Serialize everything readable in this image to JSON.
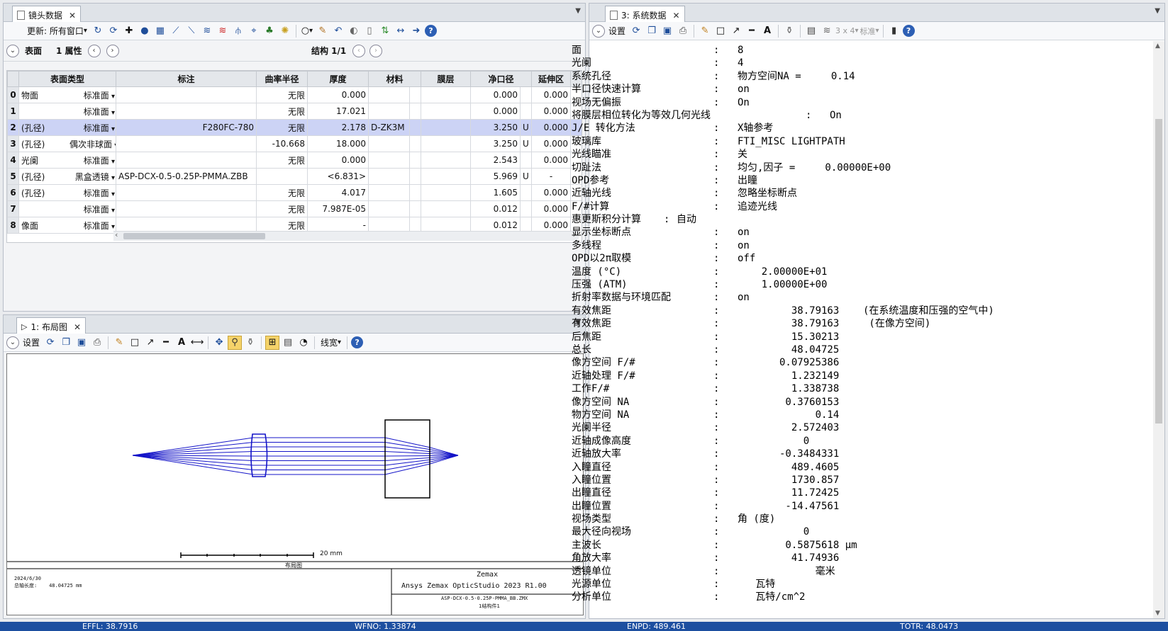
{
  "lens_panel": {
    "tab_title": "镜头数据",
    "toolbar_update_label": "更新: 所有窗口",
    "nav_surface_label": "表面",
    "nav_props_label": "1 属性",
    "nav_config_label": "结构 1/1",
    "columns": [
      "表面类型",
      "标注",
      "曲率半径",
      "厚度",
      "材料",
      "膜层",
      "净口径",
      "延伸区"
    ],
    "rows": [
      {
        "idx": "0",
        "name": "物面",
        "type": "标准面",
        "comment": "",
        "radius": "无限",
        "thickness": "0.000",
        "material": "",
        "coating": "",
        "clear": "0.000",
        "u": "",
        "ext": "0.000"
      },
      {
        "idx": "1",
        "name": "",
        "type": "标准面",
        "comment": "",
        "radius": "无限",
        "thickness": "17.021",
        "material": "",
        "coating": "",
        "clear": "0.000",
        "u": "",
        "ext": "0.000"
      },
      {
        "idx": "2",
        "name": "(孔径)",
        "type": "标准面",
        "comment": "F280FC-780",
        "radius": "无限",
        "thickness": "2.178",
        "material": "D-ZK3M",
        "coating": "",
        "clear": "3.250",
        "u": "U",
        "ext": "0.000"
      },
      {
        "idx": "3",
        "name": "(孔径)",
        "type": "偶次非球面",
        "comment": "",
        "radius": "-10.668",
        "thickness": "18.000",
        "material": "",
        "coating": "",
        "clear": "3.250",
        "u": "U",
        "ext": "0.000"
      },
      {
        "idx": "4",
        "name": "光阑",
        "type": "标准面",
        "comment": "",
        "radius": "无限",
        "thickness": "0.000",
        "material": "",
        "coating": "",
        "clear": "2.543",
        "u": "",
        "ext": "0.000"
      },
      {
        "idx": "5",
        "name": "(孔径)",
        "type": "黑盒透镜",
        "comment": "ASP-DCX-0.5-0.25P-PMMA.ZBB",
        "radius": "",
        "thickness": "<6.831>",
        "material": "",
        "coating": "",
        "clear": "5.969",
        "u": "U",
        "ext": "-"
      },
      {
        "idx": "6",
        "name": "(孔径)",
        "type": "标准面",
        "comment": "",
        "radius": "无限",
        "thickness": "4.017",
        "material": "",
        "coating": "",
        "clear": "1.605",
        "u": "",
        "ext": "0.000"
      },
      {
        "idx": "7",
        "name": "",
        "type": "标准面",
        "comment": "",
        "radius": "无限",
        "thickness": "7.987E-05",
        "material": "",
        "coating": "",
        "clear": "0.012",
        "u": "",
        "ext": "0.000"
      },
      {
        "idx": "8",
        "name": "像面",
        "type": "标准面",
        "comment": "",
        "radius": "无限",
        "thickness": "-",
        "material": "",
        "coating": "",
        "clear": "0.012",
        "u": "",
        "ext": "0.000"
      }
    ]
  },
  "layout_panel": {
    "tab_title": "1: 布局图",
    "settings_label": "设置",
    "linewidth_label": "线宽",
    "scale_label": "20 mm",
    "plot_title": "布局图",
    "date": "2024/6/30",
    "total_length": "总轴长度:    48.04725 mm",
    "brand": "Zemax",
    "product": "Ansys Zemax OpticStudio 2023 R1.00",
    "file": "ASP-DCX-0.5-0.25P-PMMA_BB.ZMX",
    "config": "1结构件1"
  },
  "sys_panel": {
    "tab_title": "3: 系统数据",
    "settings_label": "设置",
    "grid_label": "3 x 4",
    "std_label": "标准",
    "lines": [
      {
        "k": "面",
        "v": "8"
      },
      {
        "k": "光阑",
        "v": "4"
      },
      {
        "k": "系统孔径",
        "v": "物方空间NA =     0.14"
      },
      {
        "k": "半口径快速计算",
        "v": "on"
      },
      {
        "k": "视场无偏振",
        "v": "On"
      },
      {
        "k": "将膜层相位转化为等效几何光线",
        "v": "On"
      },
      {
        "k": "J/E 转化方法",
        "v": "X轴参考"
      },
      {
        "k": "玻璃库",
        "v": "FTI_MISC LIGHTPATH"
      },
      {
        "k": "光线瞄准",
        "v": "关"
      },
      {
        "k": "切趾法",
        "v": "均匀,因子 =     0.00000E+00"
      },
      {
        "k": "OPD参考",
        "v": "出瞳"
      },
      {
        "k": "近轴光线",
        "v": "忽略坐标断点"
      },
      {
        "k": "F/#计算",
        "v": "追迹光线"
      },
      {
        "k": "惠更斯积分计算",
        "v": "自动"
      },
      {
        "k": "显示坐标断点",
        "v": "on"
      },
      {
        "k": "多线程",
        "v": "on"
      },
      {
        "k": "OPD以2π取模",
        "v": "off"
      },
      {
        "k": "温度 (°C)",
        "v": "    2.00000E+01"
      },
      {
        "k": "压强 (ATM)",
        "v": "    1.00000E+00"
      },
      {
        "k": "折射率数据与环境匹配",
        "v": "on"
      },
      {
        "k": "有效焦距",
        "v": "         38.79163    (在系统温度和压强的空气中)"
      },
      {
        "k": "有效焦距",
        "v": "         38.79163     (在像方空间)"
      },
      {
        "k": "后焦距",
        "v": "         15.30213"
      },
      {
        "k": "总长",
        "v": "         48.04725"
      },
      {
        "k": "像方空间 F/#",
        "v": "       0.07925386"
      },
      {
        "k": "近轴处理 F/#",
        "v": "         1.232149"
      },
      {
        "k": "工作F/#",
        "v": "         1.338738"
      },
      {
        "k": "像方空间 NA",
        "v": "        0.3760153"
      },
      {
        "k": "物方空间 NA",
        "v": "             0.14"
      },
      {
        "k": "光阑半径",
        "v": "         2.572403"
      },
      {
        "k": "近轴成像高度",
        "v": "           0"
      },
      {
        "k": "近轴放大率",
        "v": "       -0.3484331"
      },
      {
        "k": "入瞳直径",
        "v": "         489.4605"
      },
      {
        "k": "入瞳位置",
        "v": "         1730.857"
      },
      {
        "k": "出瞳直径",
        "v": "         11.72425"
      },
      {
        "k": "出瞳位置",
        "v": "        -14.47561"
      },
      {
        "k": "视场类型",
        "v": "角 (度)"
      },
      {
        "k": "最大径向视场",
        "v": "           0"
      },
      {
        "k": "主波长",
        "v": "        0.5875618 µm"
      },
      {
        "k": "角放大率",
        "v": "         41.74936"
      },
      {
        "k": "透镜单位",
        "v": "             毫米"
      },
      {
        "k": "光源单位",
        "v": "   瓦特"
      },
      {
        "k": "分析单位",
        "v": "   瓦特/cm^2"
      }
    ]
  },
  "status": {
    "effl": "EFFL: 38.7916",
    "wfno": "WFNO: 1.33874",
    "enpd": "ENPD: 489.461",
    "totr": "TOTR: 48.0473"
  },
  "colors": {
    "ray": "#1414c8",
    "selected_row": "#ccd3f5",
    "status_bar": "#1d4fa0"
  }
}
